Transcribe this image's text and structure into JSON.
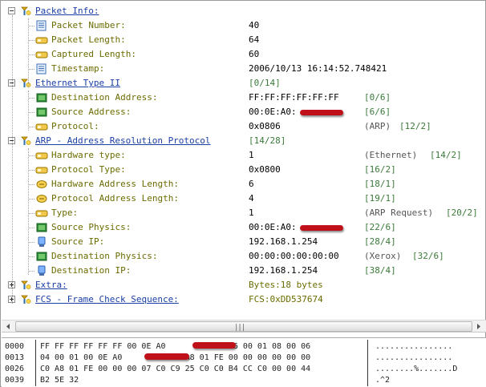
{
  "tree": {
    "packet_info": {
      "title": "Packet Info:",
      "fields": [
        {
          "label": "Packet Number:",
          "value": "40"
        },
        {
          "label": "Packet Length:",
          "value": "64"
        },
        {
          "label": "Captured Length:",
          "value": "60"
        },
        {
          "label": "Timestamp:",
          "value": "2006/10/13 16:14:52.748421"
        }
      ]
    },
    "ethernet": {
      "title": "Ethernet Type II",
      "offset": "[0/14]",
      "fields": [
        {
          "label": "Destination Address:",
          "value": "FF:FF:FF:FF:FF:FF",
          "offset": "[0/6]"
        },
        {
          "label": "Source Address:",
          "value": "00:0E:A0:",
          "offset": "[6/6]"
        },
        {
          "label": "Protocol:",
          "value": "0x0806",
          "meta": "(ARP)",
          "offset": "[12/2]"
        }
      ]
    },
    "arp": {
      "title": "ARP - Address Resolution Protocol",
      "offset": "[14/28]",
      "fields": [
        {
          "label": "Hardware type:",
          "value": "1",
          "meta": "(Ethernet)",
          "offset": "[14/2]"
        },
        {
          "label": "Protocol Type:",
          "value": "0x0800",
          "offset": "[16/2]"
        },
        {
          "label": "Hardware Address Length:",
          "value": "6",
          "offset": "[18/1]"
        },
        {
          "label": "Protocol Address Length:",
          "value": "4",
          "offset": "[19/1]"
        },
        {
          "label": "Type:",
          "value": "1",
          "meta": "(ARP Request)",
          "offset": "[20/2]"
        },
        {
          "label": "Source Physics:",
          "value": "00:0E:A0:",
          "offset": "[22/6]"
        },
        {
          "label": "Source IP:",
          "value": "192.168.1.254",
          "offset": "[28/4]"
        },
        {
          "label": "Destination Physics:",
          "value": "00:00:00:00:00:00",
          "meta": "(Xerox)",
          "offset": "[32/6]"
        },
        {
          "label": "Destination IP:",
          "value": "192.168.1.254",
          "offset": "[38/4]"
        }
      ]
    },
    "extra": {
      "title": "Extra:",
      "value": "Bytes:18 bytes"
    },
    "fcs": {
      "title": "FCS - Frame Check Sequence:",
      "value": "FCS:0xDD537674"
    }
  },
  "scrollbar": {
    "grip": "|||"
  },
  "hex": {
    "rows": [
      {
        "offset": "0000",
        "bytes": "FF FF FF FF FF FF 00 0E A0          08 06 00 01 08 00 06",
        "ascii": "................"
      },
      {
        "offset": "0013",
        "bytes": "04 00 01 00 0E A0          C0 A8 01 FE 00 00 00 00 00 00",
        "ascii": "................"
      },
      {
        "offset": "0026",
        "bytes": "C0 A8 01 FE 00 00 00 07 C0 C9 25 C0 C0 B4 CC C0 00 00 44",
        "ascii": "........%.......D"
      },
      {
        "offset": "0039",
        "bytes": "B2 5E 32",
        "ascii": ".^2"
      }
    ]
  },
  "colors": {
    "header": "#1a3fa6",
    "field": "#6b6b00",
    "offset": "#3a7a3a",
    "redaction": "#c0111a"
  }
}
